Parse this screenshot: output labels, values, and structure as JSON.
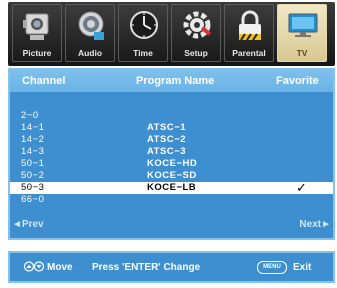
{
  "tabs": [
    {
      "label": "Picture",
      "icon": "camera-icon"
    },
    {
      "label": "Audio",
      "icon": "speaker-icon"
    },
    {
      "label": "Time",
      "icon": "clock-icon"
    },
    {
      "label": "Setup",
      "icon": "gear-icon"
    },
    {
      "label": "Parental",
      "icon": "lock-icon"
    },
    {
      "label": "TV",
      "icon": "tv-icon",
      "active": true
    }
  ],
  "header": {
    "channel": "Channel",
    "program_name": "Program Name",
    "favorite": "Favorite"
  },
  "rows": [
    {
      "channel": "2−0",
      "program": "",
      "favorite": ""
    },
    {
      "channel": "14−1",
      "program": "ATSC−1",
      "favorite": ""
    },
    {
      "channel": "14−2",
      "program": "ATSC−2",
      "favorite": ""
    },
    {
      "channel": "14−3",
      "program": "ATSC−3",
      "favorite": ""
    },
    {
      "channel": "50−1",
      "program": "KOCE−HD",
      "favorite": ""
    },
    {
      "channel": "50−2",
      "program": "KOCE−SD",
      "favorite": ""
    },
    {
      "channel": "50−3",
      "program": "KOCE−LB",
      "favorite": "✓",
      "selected": true
    },
    {
      "channel": "66−0",
      "program": "",
      "favorite": ""
    }
  ],
  "nav": {
    "prev": "◄Prev",
    "next": "Next►"
  },
  "hints": {
    "move": "Move",
    "change": "Press 'ENTER' Change",
    "menu_key": "MENU",
    "exit": "Exit"
  },
  "colors": {
    "panel": "#3d8fcf",
    "border": "#84c3ee",
    "selected_row": "#ffffff",
    "tabbar": "#1f1f1f",
    "active_tab": "#e6d9a6"
  }
}
